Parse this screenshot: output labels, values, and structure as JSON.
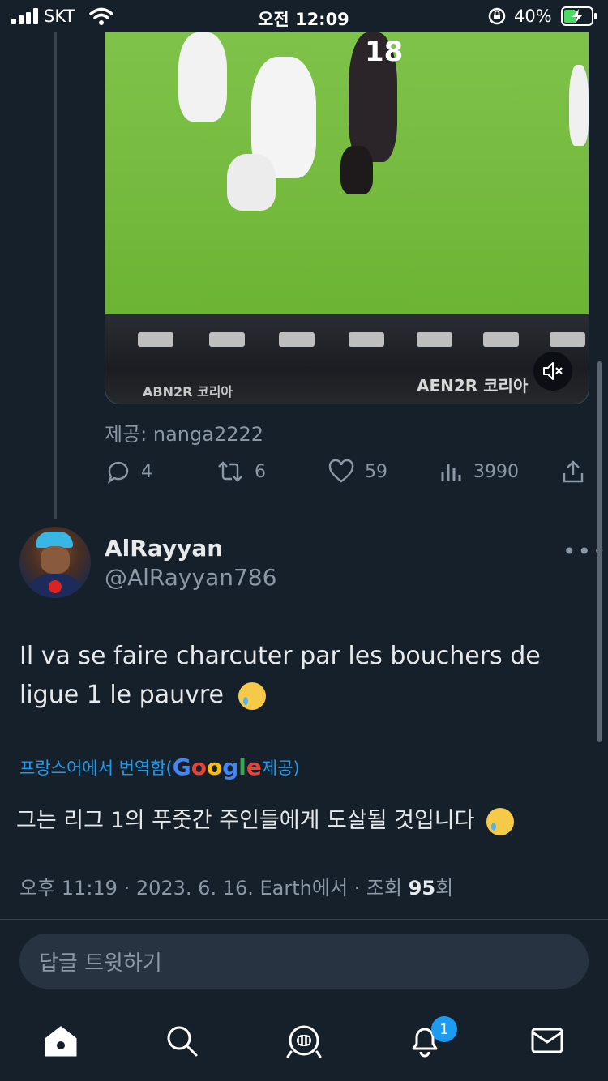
{
  "status_bar": {
    "carrier": "SKT",
    "time": "오전 12:09",
    "battery": "40%"
  },
  "video": {
    "source_label": "제공: nanga2222",
    "jersey_number": "18",
    "board_text_1": "ABN2R 코리아",
    "board_text_2": "AEN2R 코리아"
  },
  "prev_tweet_actions": {
    "replies": "4",
    "retweets": "6",
    "likes": "59",
    "views": "3990"
  },
  "tweet": {
    "display_name": "AlRayyan",
    "handle": "@AlRayyan786",
    "text": "Il va se faire charcuter par les bouchers de ligue 1 le pauvre",
    "translate_prefix": "프랑스어에서 번역함(",
    "translate_google": "Google",
    "translate_suffix": " 제공)",
    "translated_text": "그는 리그 1의 푸줏간 주인들에게 도살될 것입니다",
    "meta_prefix": "오후 11:19 · 2023. 6. 16. Earth에서 · 조회 ",
    "views": "95",
    "meta_suffix": "회"
  },
  "reply_box": {
    "placeholder": "답글 트윗하기"
  },
  "tab_bar": {
    "notification_count": "1"
  },
  "colors": {
    "background": "#15202b",
    "accent": "#1d9bf0",
    "muted": "#8b98a5"
  }
}
